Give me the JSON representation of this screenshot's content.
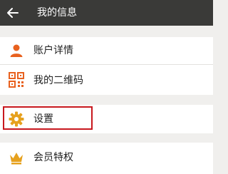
{
  "header": {
    "title": "我的信息"
  },
  "menu": {
    "account_details": "账户详情",
    "my_qr_code": "我的二维码",
    "settings": "设置",
    "vip_privileges": "会员特权"
  },
  "colors": {
    "header_bg": "#3a3a38",
    "page_bg": "#f0efed",
    "icon_orange": "#e8611f",
    "icon_gold": "#e6a11e",
    "highlight_red": "#c8181e"
  },
  "icons": {
    "back": "arrow-left-icon",
    "account": "person-icon",
    "qr": "qr-code-icon",
    "settings": "gear-icon",
    "vip": "crown-icon"
  }
}
